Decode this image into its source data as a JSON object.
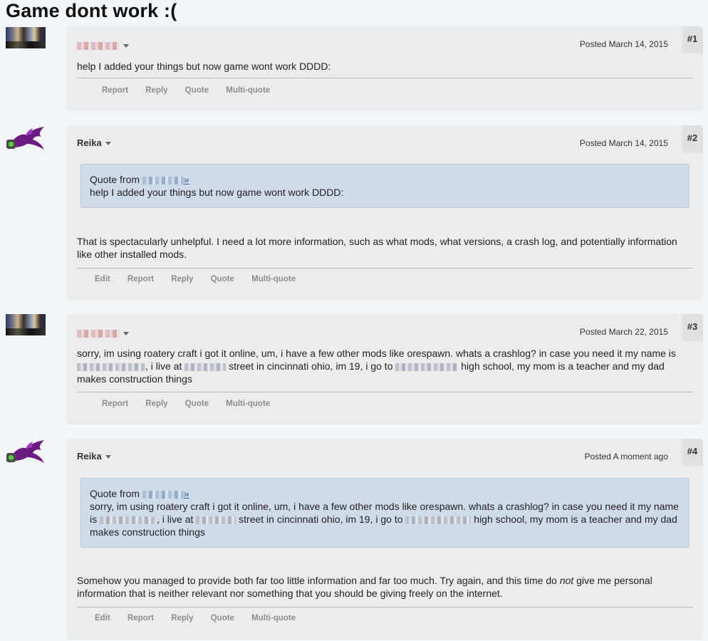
{
  "title": "Game dont work :(",
  "posts": [
    {
      "number": "#1",
      "author": "",
      "date": "Posted March 14, 2015",
      "body": "help I added your things but now game wont work DDDD:",
      "actions": [
        "Report",
        "Reply",
        "Quote",
        "Multi-quote"
      ]
    },
    {
      "number": "#2",
      "author": "Reika",
      "date": "Posted March 14, 2015",
      "quote_prefix": "Quote from",
      "quote_link": "»",
      "quote_text": "help I added your things but now game wont work DDDD:",
      "body": "That is spectacularly unhelpful. I need a lot more information, such as what mods, what versions, a crash log, and potentially information like other installed mods.",
      "actions": [
        "Edit",
        "Report",
        "Reply",
        "Quote",
        "Multi-quote"
      ]
    },
    {
      "number": "#3",
      "author": "",
      "date": "Posted March 22, 2015",
      "body_parts": [
        "sorry, im using roatery craft i got it online, um, i have a few other mods like orespawn. whats a crashlog? in case you need it my name is",
        ", i live at",
        "street in cincinnati ohio, im 19, i go to",
        "high school, my mom is a teacher and my dad makes construction things"
      ],
      "actions": [
        "Report",
        "Reply",
        "Quote",
        "Multi-quote"
      ]
    },
    {
      "number": "#4",
      "author": "Reika",
      "date": "Posted A moment ago",
      "quote_prefix": "Quote from",
      "quote_link": "»",
      "quote_parts": [
        "sorry, im using roatery craft i got it online, um, i have a few other mods like orespawn. whats a crashlog? in case you need it my name is",
        ", i live at",
        "street in cincinnati ohio, im 19, i go to",
        "high school, my mom is a teacher and my dad makes construction things"
      ],
      "body_before": "Somehow you managed to provide both far too little information and far too much. Try again, and this time do",
      "body_emph": "not",
      "body_after": "give me personal information that is neither relevant nor something that you should be giving freely on the internet.",
      "actions": [
        "Edit",
        "Report",
        "Reply",
        "Quote",
        "Multi-quote"
      ]
    }
  ]
}
